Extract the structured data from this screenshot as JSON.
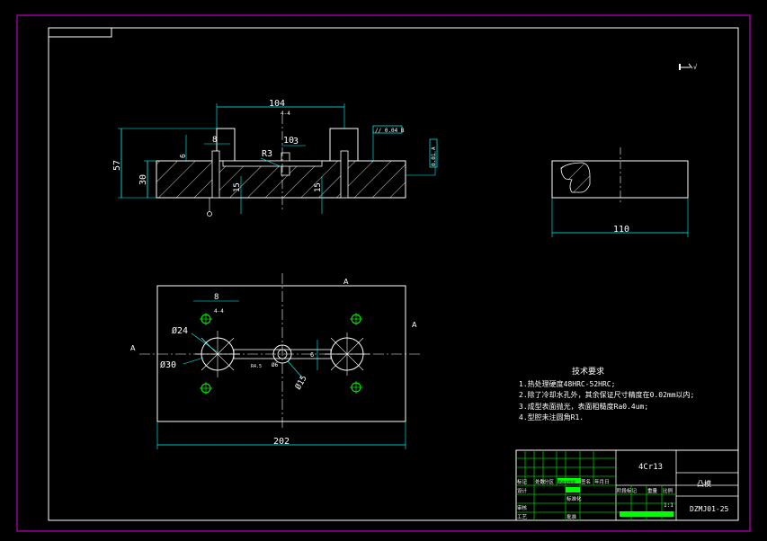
{
  "dimensions": {
    "top_width": "104",
    "top_sub": "4-4",
    "side_height": "57",
    "side_thickness": "30",
    "small_left": "8",
    "ch_left": "6",
    "r3": "R3",
    "dim_10": "10",
    "dim_3": "3",
    "dim_15a": "15",
    "dim_15b": "15",
    "right_width": "110",
    "flat_small": "8",
    "flat_sub": "4-4",
    "dia24": "Ø24",
    "dia30": "Ø30",
    "dia6": "Ø6",
    "dia15": "Ø15",
    "r45": "R4.5",
    "dim_6": "6",
    "plan_width": "202"
  },
  "gdt": {
    "flatness": "// 0.04 B",
    "box": "0.01 A"
  },
  "symbols": {
    "roughness_corner": "√",
    "section_marks": [
      "A",
      "A",
      "A"
    ]
  },
  "notes": {
    "title": "技术要求",
    "items": [
      "1.热处理硬度48HRC-52HRC;",
      "2.除了冷却水孔外，其余保证尺寸精度在0.02mm以内;",
      "3.成型表面抛光，表面粗糙度Ra0.4um;",
      "4.型腔未注圆角R1."
    ]
  },
  "title_block": {
    "material": "4Cr13",
    "part_name": "凸模",
    "drawing_no": "DZMJ01-25",
    "scale": "1:1",
    "row_labels": [
      "标记",
      "处数",
      "分区",
      "更改文件号",
      "签名",
      "年月日"
    ],
    "left_labels": [
      "设计",
      "审核",
      "工艺"
    ],
    "mid_labels": [
      "标准化",
      "批准"
    ],
    "stage_labels": [
      "阶段标记",
      "重量",
      "比例"
    ]
  }
}
